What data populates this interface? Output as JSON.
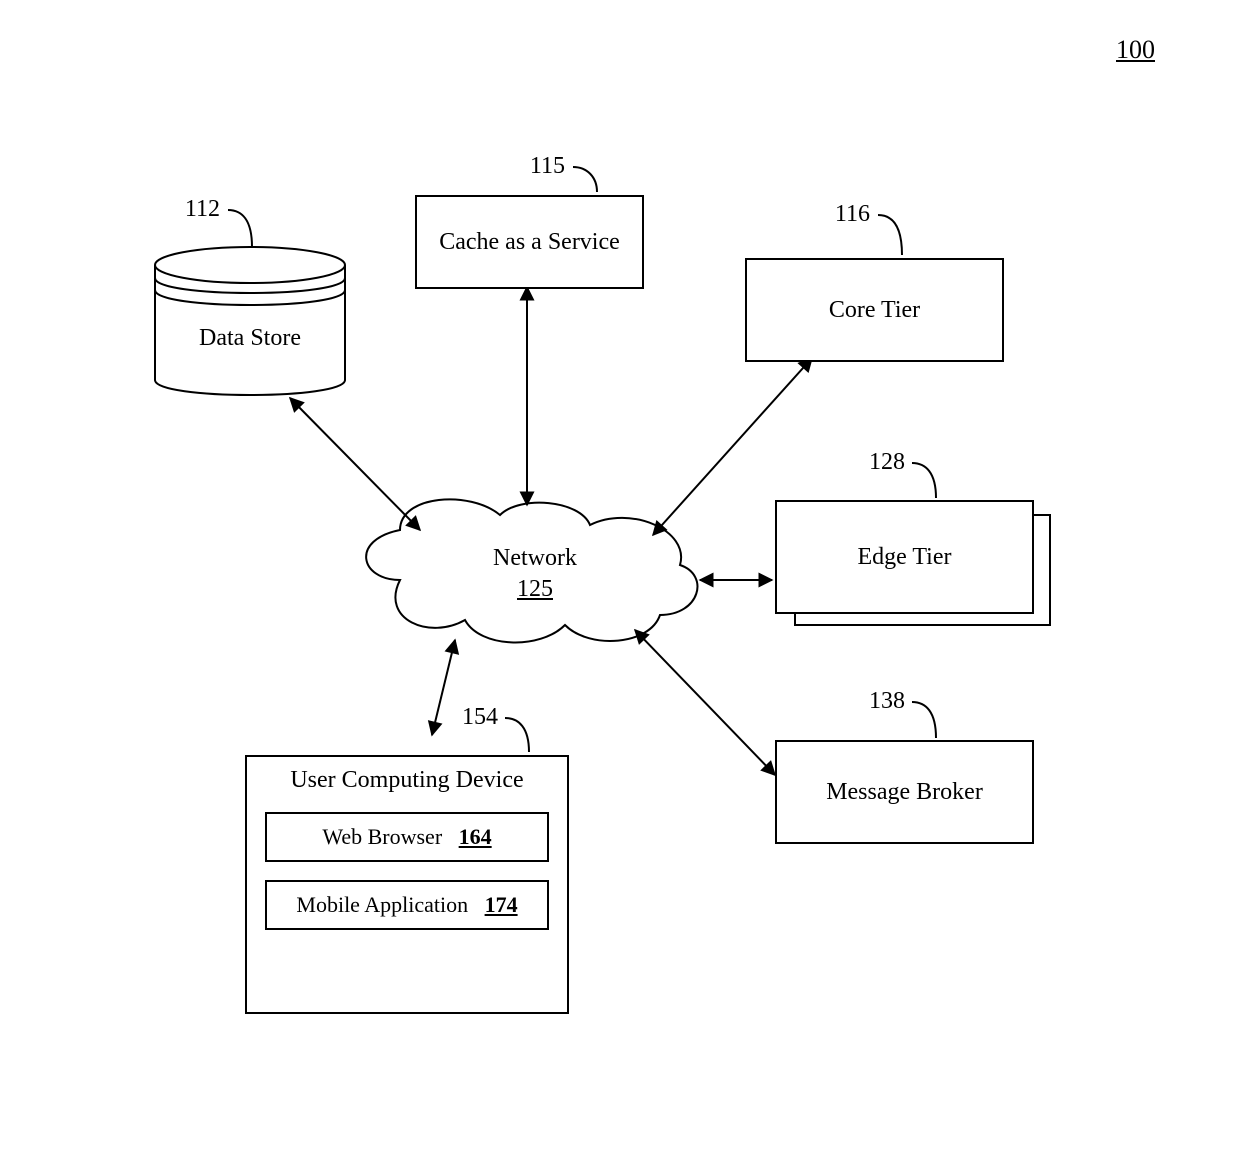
{
  "figure_number": "100",
  "nodes": {
    "data_store": {
      "ref": "112",
      "label": "Data Store"
    },
    "cache": {
      "ref": "115",
      "label": "Cache as a Service"
    },
    "core_tier": {
      "ref": "116",
      "label": "Core Tier"
    },
    "edge_tier": {
      "ref": "128",
      "label": "Edge Tier"
    },
    "msg_broker": {
      "ref": "138",
      "label": "Message Broker"
    },
    "network": {
      "ref": "125",
      "label": "Network"
    },
    "ucd": {
      "ref": "154",
      "title": "User Computing Device",
      "web_browser": {
        "label": "Web Browser",
        "ref": "164"
      },
      "mobile_app": {
        "label": "Mobile Application",
        "ref": "174"
      }
    }
  }
}
